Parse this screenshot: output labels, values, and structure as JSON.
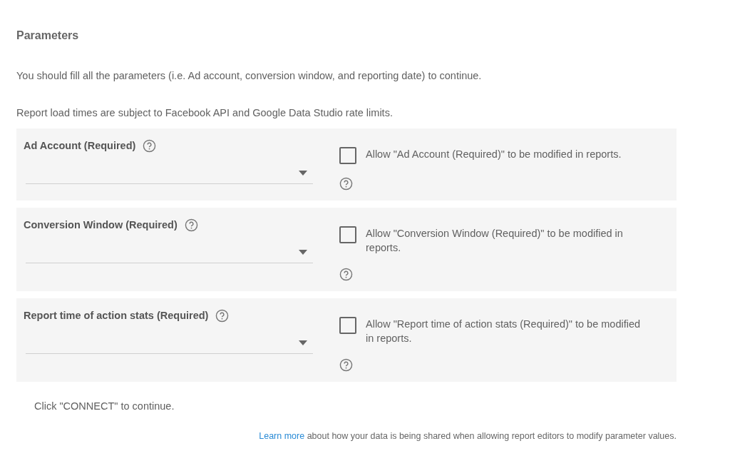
{
  "title": "Parameters",
  "notes": [
    "You should fill all the parameters (i.e. Ad account, conversion window, and reporting date) to continue.",
    "Report load times are subject to Facebook API and Google Data Studio rate limits."
  ],
  "parameters": [
    {
      "label": "Ad Account (Required)",
      "allow_label": "Allow \"Ad Account (Required)\" to be modified in reports.",
      "allow_checked": false
    },
    {
      "label": "Conversion Window (Required)",
      "allow_label": "Allow \"Conversion Window (Required)\" to be modified in reports.",
      "allow_checked": false
    },
    {
      "label": "Report time of action stats (Required)",
      "allow_label": "Allow \"Report time of action stats (Required)\" to be modified in reports.",
      "allow_checked": false
    }
  ],
  "connect_note": "Click \"CONNECT\" to continue.",
  "learn_more": {
    "link": "Learn more",
    "text": "about how your data is being shared when allowing report editors to modify parameter values."
  }
}
